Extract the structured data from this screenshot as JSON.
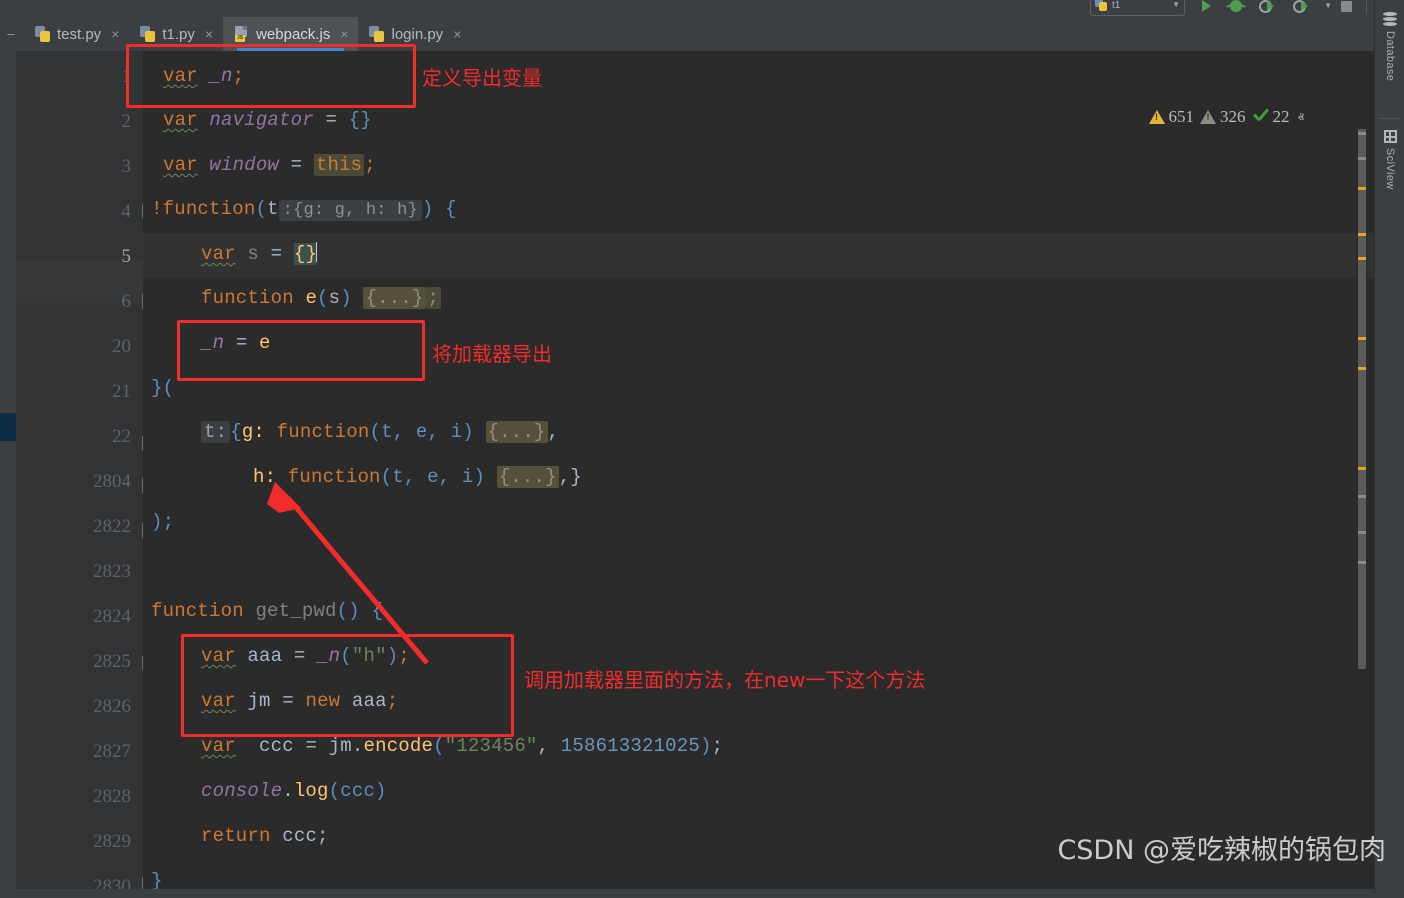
{
  "toolbar": {
    "run_config_label": "t1",
    "buttons": [
      {
        "name": "run-button",
        "icon": "play-icon"
      },
      {
        "name": "debug-button",
        "icon": "bug-icon"
      },
      {
        "name": "run-with-coverage-button",
        "icon": "coverage-icon"
      },
      {
        "name": "profile-button",
        "icon": "profile-icon"
      },
      {
        "name": "stop-button",
        "icon": "stop-icon"
      },
      {
        "name": "search-everywhere-button",
        "icon": "search-icon"
      }
    ]
  },
  "tabs": [
    {
      "label": "test.py",
      "icon": "python-file-icon",
      "active": false
    },
    {
      "label": "t1.py",
      "icon": "python-file-icon",
      "active": false
    },
    {
      "label": "webpack.js",
      "icon": "javascript-file-icon",
      "active": true
    },
    {
      "label": "login.py",
      "icon": "python-file-icon",
      "active": false
    }
  ],
  "tab_close_glyph": "×",
  "inspections": {
    "warnings": "651",
    "weak_warnings": "326",
    "checks": "22",
    "prev_glyph": "ⱏ",
    "next_glyph": "ⱟ"
  },
  "right_tools": [
    {
      "label": "Database",
      "icon": "database-icon"
    },
    {
      "label": "SciView",
      "icon": "grid-icon"
    }
  ],
  "editor": {
    "line_numbers": [
      "1",
      "2",
      "3",
      "4",
      "5",
      "6",
      "20",
      "21",
      "22",
      "2804",
      "2822",
      "2823",
      "2824",
      "2825",
      "2826",
      "2827",
      "2828",
      "2829",
      "2830"
    ],
    "current_line": "5",
    "lines": {
      "l1": {
        "kw": "var",
        "name": "_n",
        "semi": ";"
      },
      "l2": {
        "kw": "var",
        "name": "navigator",
        "eq": "=",
        "val": "{}"
      },
      "l3": {
        "kw": "var",
        "name": "window",
        "eq": "=",
        "val": "this",
        "semi": ";"
      },
      "l4": {
        "bang": "!",
        "kw": "function",
        "open": "(",
        "param": "t",
        "hint": ":{g: g, h: h}",
        "close": ")",
        "brace": "{"
      },
      "l5": {
        "kw": "var",
        "name": "s",
        "eq": "=",
        "val": "{}"
      },
      "l6": {
        "kw": "function",
        "name": "e",
        "open": "(",
        "param": "s",
        "close": ")",
        "body": "{...}",
        "semi": ";"
      },
      "l20": {
        "name": "_n",
        "eq": "=",
        "val": "e"
      },
      "l21": {
        "text": "}("
      },
      "l22": {
        "label": "t:",
        "open": "{",
        "key": "g:",
        "kw": "function",
        "args": "(t, e, i)",
        "body": "{...}",
        "tail": ","
      },
      "l2804": {
        "key": "h:",
        "kw": "function",
        "args": "(t, e, i)",
        "body": "{...}",
        "tail": ",}"
      },
      "l2822": {
        "text": ");"
      },
      "l2823": {
        "text": ""
      },
      "l2824": {
        "kw": "function",
        "name": "get_pwd",
        "args": "()",
        "brace": "{"
      },
      "l2825": {
        "kw": "var",
        "name": "aaa",
        "eq": "=",
        "call": "_n",
        "open": "(",
        "str": "\"h\"",
        "close": ")",
        "semi": ";"
      },
      "l2826": {
        "kw": "var",
        "name": "jm",
        "eq": "=",
        "newkw": "new",
        "val": "aaa",
        "semi": ";"
      },
      "l2827": {
        "kw": "var",
        "name": "ccc",
        "eq": "=",
        "obj": "jm.",
        "method": "encode",
        "open": "(",
        "str": "\"123456\"",
        "comma": ",",
        "num": "158613321025",
        "close": ")",
        "semi": ";"
      },
      "l2828": {
        "obj": "console",
        "dot": ".",
        "method": "log",
        "args": "(ccc)"
      },
      "l2829": {
        "kw": "return",
        "val": "ccc",
        "semi": ";"
      },
      "l2830": {
        "text": "}"
      }
    }
  },
  "annotations": [
    {
      "name": "annotation-define-export-var",
      "text": "定义导出变量"
    },
    {
      "name": "annotation-export-loader",
      "text": "将加载器导出"
    },
    {
      "name": "annotation-call-loader-method",
      "text": "调用加载器里面的方法，在new一下这个方法"
    }
  ],
  "watermark": "CSDN @爱吃辣椒的锅包肉",
  "colors": {
    "editor_bg": "#2b2b2b",
    "chrome_bg": "#3c3f41",
    "gutter_bg": "#313335",
    "keyword": "#cc7832",
    "string": "#6a8759",
    "number": "#6897bb",
    "function": "#ffc66d",
    "field": "#9876aa",
    "annotation_red": "#f22b2b",
    "active_tab_underline": "#3d86cc",
    "warning_yellow": "#e8b339"
  }
}
